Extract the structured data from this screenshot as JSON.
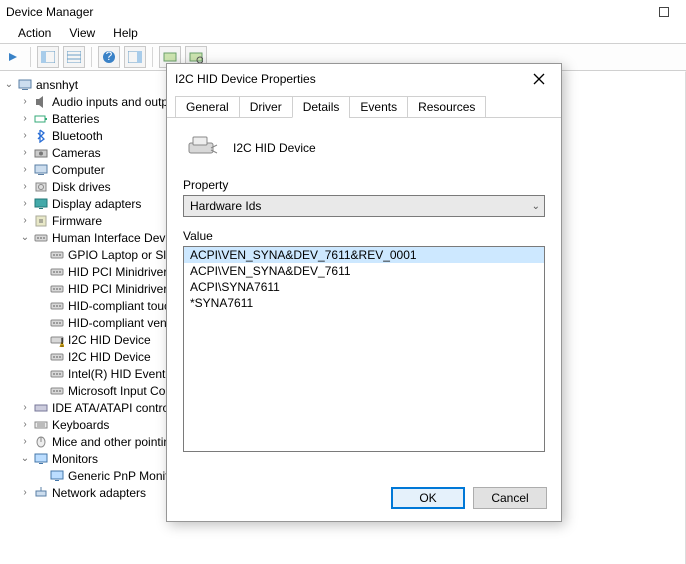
{
  "window": {
    "title": "Device Manager"
  },
  "menu": {
    "action": "Action",
    "view": "View",
    "help": "Help"
  },
  "tree": {
    "root": "ansnhyt",
    "items": [
      {
        "label": "Audio inputs and outputs",
        "icon": "speaker",
        "arrow": ">",
        "ind": 1
      },
      {
        "label": "Batteries",
        "icon": "battery",
        "arrow": ">",
        "ind": 1
      },
      {
        "label": "Bluetooth",
        "icon": "bluetooth",
        "arrow": ">",
        "ind": 1
      },
      {
        "label": "Cameras",
        "icon": "camera",
        "arrow": ">",
        "ind": 1
      },
      {
        "label": "Computer",
        "icon": "computer",
        "arrow": ">",
        "ind": 1
      },
      {
        "label": "Disk drives",
        "icon": "disk",
        "arrow": ">",
        "ind": 1
      },
      {
        "label": "Display adapters",
        "icon": "display",
        "arrow": ">",
        "ind": 1
      },
      {
        "label": "Firmware",
        "icon": "firmware",
        "arrow": ">",
        "ind": 1
      },
      {
        "label": "Human Interface Devices",
        "icon": "hid",
        "arrow": "v",
        "ind": 1
      },
      {
        "label": "GPIO Laptop or Slate Indicator Driver",
        "icon": "hid",
        "arrow": "",
        "ind": 2
      },
      {
        "label": "HID PCI Minidriver for ISS",
        "icon": "hid",
        "arrow": "",
        "ind": 2
      },
      {
        "label": "HID PCI Minidriver for ISS",
        "icon": "hid",
        "arrow": "",
        "ind": 2
      },
      {
        "label": "HID-compliant touchscreen",
        "icon": "hid",
        "arrow": "",
        "ind": 2
      },
      {
        "label": "HID-compliant vendor-defined device",
        "icon": "hid",
        "arrow": "",
        "ind": 2
      },
      {
        "label": "I2C HID Device",
        "icon": "warn",
        "arrow": "",
        "ind": 2
      },
      {
        "label": "I2C HID Device",
        "icon": "hid",
        "arrow": "",
        "ind": 2
      },
      {
        "label": "Intel(R) HID Event Filter",
        "icon": "hid",
        "arrow": "",
        "ind": 2
      },
      {
        "label": "Microsoft Input Configuration Device",
        "icon": "hid",
        "arrow": "",
        "ind": 2
      },
      {
        "label": "IDE ATA/ATAPI controllers",
        "icon": "ide",
        "arrow": ">",
        "ind": 1
      },
      {
        "label": "Keyboards",
        "icon": "keyboard",
        "arrow": ">",
        "ind": 1
      },
      {
        "label": "Mice and other pointing devices",
        "icon": "mouse",
        "arrow": ">",
        "ind": 1
      },
      {
        "label": "Monitors",
        "icon": "monitor",
        "arrow": "v",
        "ind": 1
      },
      {
        "label": "Generic PnP Monitor",
        "icon": "monitor",
        "arrow": "",
        "ind": 2
      },
      {
        "label": "Network adapters",
        "icon": "net",
        "arrow": ">",
        "ind": 1
      }
    ]
  },
  "dialog": {
    "title": "I2C HID Device Properties",
    "tabs": {
      "general": "General",
      "driver": "Driver",
      "details": "Details",
      "events": "Events",
      "resources": "Resources"
    },
    "active_tab": "details",
    "device_name": "I2C HID Device",
    "property_label": "Property",
    "property_value": "Hardware Ids",
    "value_label": "Value",
    "values": [
      "ACPI\\VEN_SYNA&DEV_7611&REV_0001",
      "ACPI\\VEN_SYNA&DEV_7611",
      "ACPI\\SYNA7611",
      "*SYNA7611"
    ],
    "ok": "OK",
    "cancel": "Cancel"
  }
}
